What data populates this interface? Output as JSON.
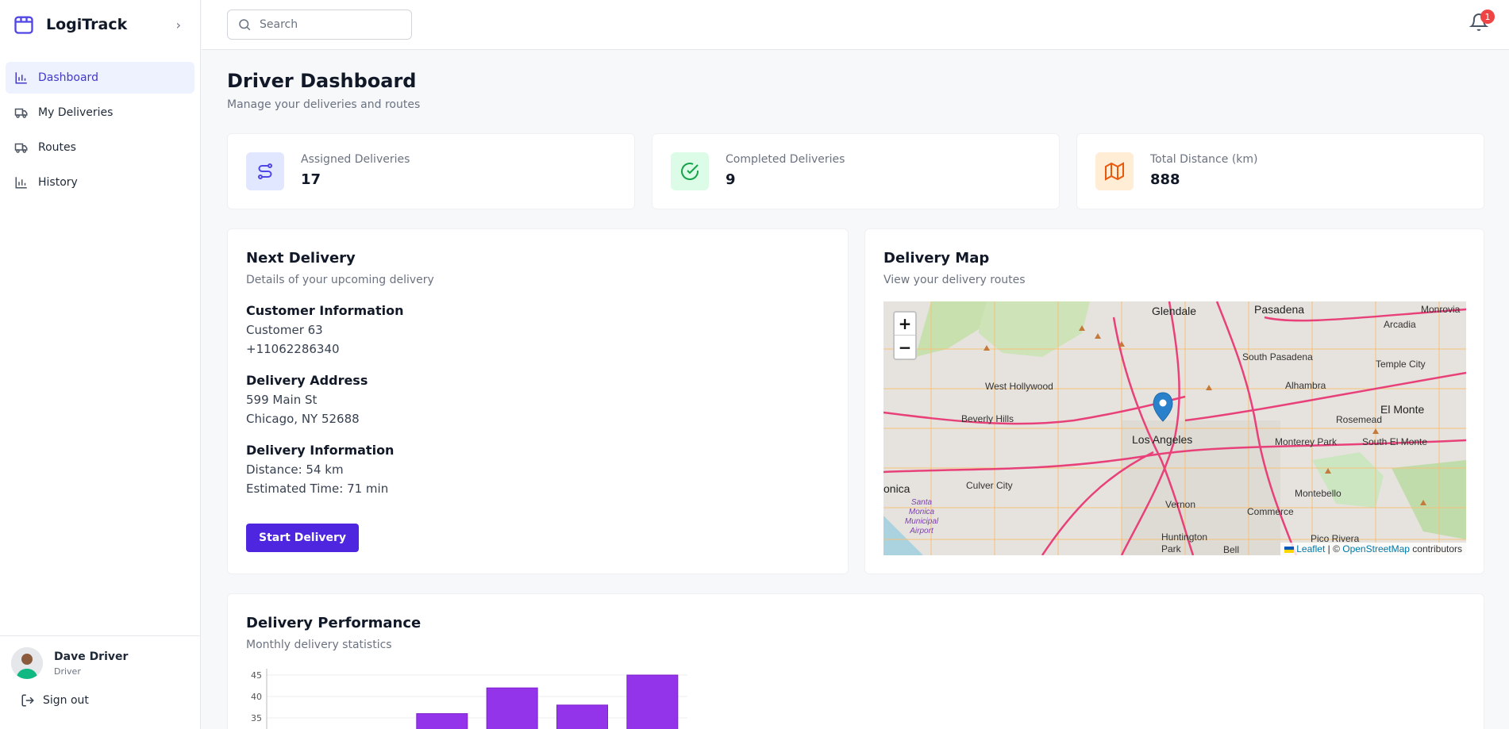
{
  "app": {
    "name": "LogiTrack"
  },
  "sidebar": {
    "items": [
      {
        "label": "Dashboard",
        "icon": "bar-chart-icon",
        "active": true
      },
      {
        "label": "My Deliveries",
        "icon": "truck-icon"
      },
      {
        "label": "Routes",
        "icon": "truck-icon"
      },
      {
        "label": "History",
        "icon": "bar-chart-icon"
      }
    ],
    "user": {
      "name": "Dave Driver",
      "role": "Driver"
    },
    "signout": "Sign out"
  },
  "topbar": {
    "search_placeholder": "Search",
    "notifications": "1"
  },
  "page": {
    "title": "Driver Dashboard",
    "subtitle": "Manage your deliveries and routes"
  },
  "stats": [
    {
      "label": "Assigned Deliveries",
      "value": "17",
      "icon": "route-icon",
      "color": "#4f46e5",
      "bg": "#e0e7ff"
    },
    {
      "label": "Completed Deliveries",
      "value": "9",
      "icon": "check-circle-icon",
      "color": "#16a34a",
      "bg": "#dcfce7"
    },
    {
      "label": "Total Distance (km)",
      "value": "888",
      "icon": "map-icon",
      "color": "#ea580c",
      "bg": "#ffedd5"
    }
  ],
  "next_delivery": {
    "title": "Next Delivery",
    "subtitle": "Details of your upcoming delivery",
    "customer_heading": "Customer Information",
    "customer_name": "Customer 63",
    "customer_phone": "+11062286340",
    "address_heading": "Delivery Address",
    "address_line1": "599 Main St",
    "address_line2": "Chicago, NY 52688",
    "info_heading": "Delivery Information",
    "distance": "Distance: 54 km",
    "eta": "Estimated Time: 71 min",
    "button": "Start Delivery"
  },
  "map": {
    "title": "Delivery Map",
    "subtitle": "View your delivery routes",
    "zoom_in": "+",
    "zoom_out": "−",
    "attribution_leaflet": "Leaflet",
    "attribution_sep": " | © ",
    "attribution_osm": "OpenStreetMap",
    "attribution_tail": " contributors",
    "labels": {
      "glendale": "Glendale",
      "pasadena": "Pasadena",
      "monrovia": "Monrovia",
      "arcadia": "Arcadia",
      "south_pasadena": "South Pasadena",
      "temple_city": "Temple City",
      "alhambra": "Alhambra",
      "west_hollywood": "West Hollywood",
      "el_monte": "El Monte",
      "beverly_hills": "Beverly Hills",
      "rosemead": "Rosemead",
      "los_angeles": "Los Angeles",
      "monterey_park": "Monterey Park",
      "south_el_monte": "South El Monte",
      "culver_city": "Culver City",
      "montebello": "Montebello",
      "monica": "onica",
      "vernon": "Vernon",
      "commerce": "Commerce",
      "santa_monica_airport": "Santa Monica Municipal Airport",
      "huntington_park": "Huntington Park",
      "bell": "Bell",
      "pico_rivera": "Pico Rivera"
    }
  },
  "performance": {
    "title": "Delivery Performance",
    "subtitle": "Monthly delivery statistics"
  },
  "chart_data": {
    "type": "bar",
    "categories": [
      "",
      "",
      "",
      "",
      "",
      ""
    ],
    "values": [
      null,
      null,
      36,
      42,
      38,
      45
    ],
    "ytick_labels": [
      "45",
      "40",
      "35"
    ],
    "ylim": [
      30,
      45
    ],
    "bar_color": "#9333ea"
  }
}
